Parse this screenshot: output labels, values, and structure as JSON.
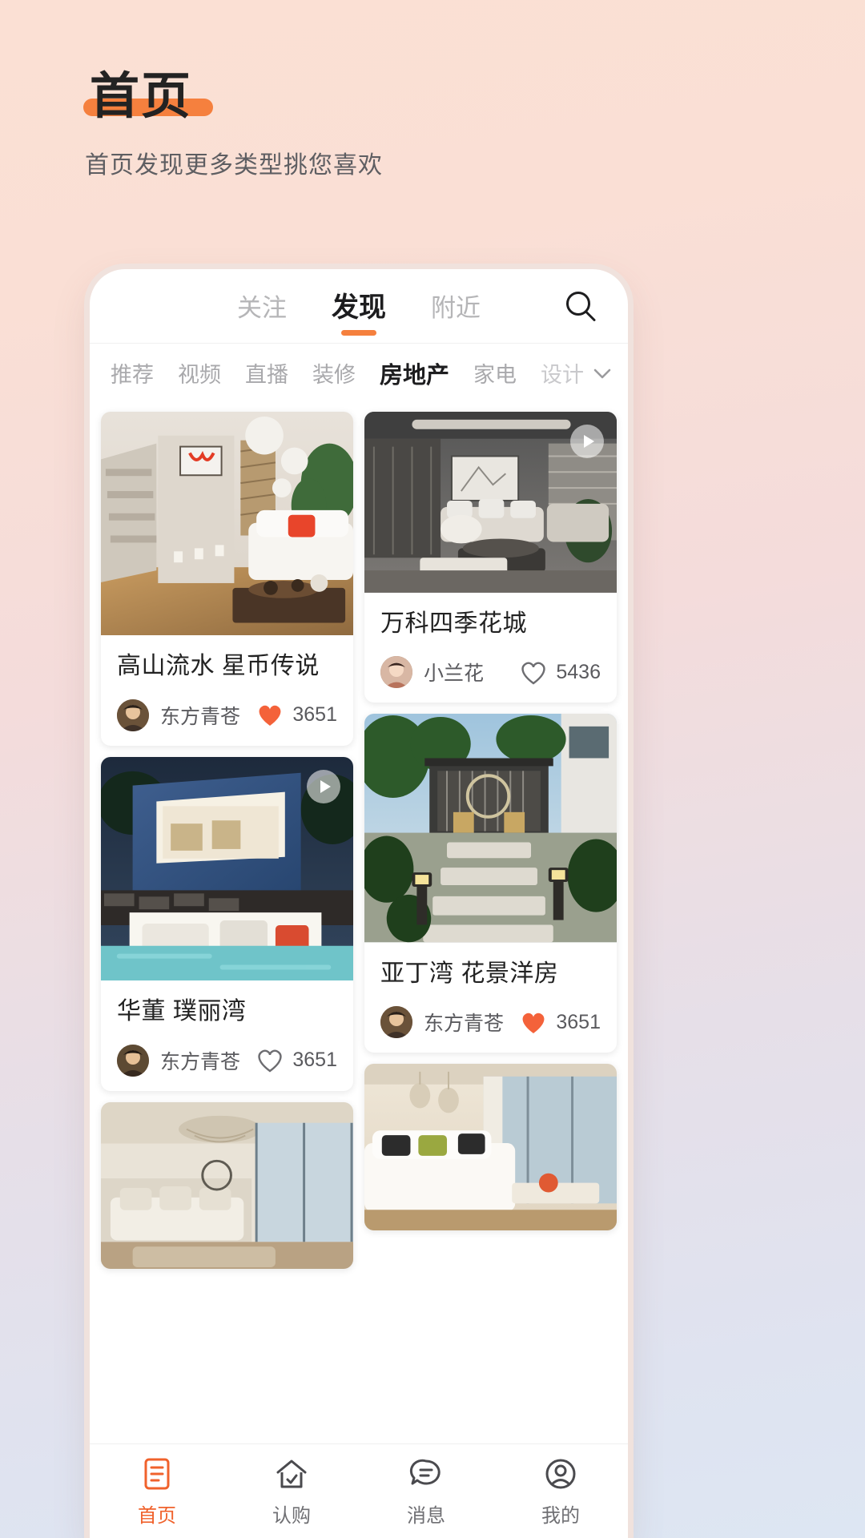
{
  "header": {
    "title": "首页",
    "subtitle": "首页发现更多类型挑您喜欢"
  },
  "colors": {
    "accent": "#f5803e",
    "accent_strong": "#f0622c",
    "heart_filled": "#f4623a",
    "text_dark": "#1d1d1f",
    "text_muted": "#a9a9ac"
  },
  "phone": {
    "topbar": {
      "tabs": [
        {
          "label": "关注",
          "active": false
        },
        {
          "label": "发现",
          "active": true
        },
        {
          "label": "附近",
          "active": false
        }
      ],
      "search_icon": "search-icon"
    },
    "categories": {
      "items": [
        {
          "label": "推荐",
          "active": false
        },
        {
          "label": "视频",
          "active": false
        },
        {
          "label": "直播",
          "active": false
        },
        {
          "label": "装修",
          "active": false
        },
        {
          "label": "房地产",
          "active": true
        },
        {
          "label": "家电",
          "active": false
        },
        {
          "label": "设计",
          "active": false,
          "faded": true
        }
      ],
      "expand_icon": "chevron-down-icon"
    },
    "feed": {
      "left_column": [
        {
          "title": "高山流水 星币传说",
          "author": "东方青苍",
          "likes": "3651",
          "liked": true,
          "has_video": false,
          "image": "living-room-stairs-red-art"
        },
        {
          "title": "华董 璞丽湾",
          "author": "东方青苍",
          "likes": "3651",
          "liked": false,
          "has_video": true,
          "image": "modern-blue-villa-pool-night"
        },
        {
          "title": "",
          "author": "",
          "likes": "",
          "liked": false,
          "has_video": false,
          "image": "classic-living-room-chandelier"
        }
      ],
      "right_column": [
        {
          "title": "万科四季花城",
          "author": "小兰花",
          "likes": "5436",
          "liked": false,
          "has_video": true,
          "image": "grey-modern-lounge-sofas"
        },
        {
          "title": "亚丁湾 花景洋房",
          "author": "东方青苍",
          "likes": "3651",
          "liked": true,
          "has_video": false,
          "image": "garden-courtyard-pavilion"
        },
        {
          "title": "",
          "author": "",
          "likes": "",
          "liked": false,
          "has_video": false,
          "image": "bright-corner-sofa-window"
        }
      ]
    },
    "bottom_nav": [
      {
        "label": "首页",
        "icon": "home-list-icon",
        "active": true
      },
      {
        "label": "认购",
        "icon": "house-icon",
        "active": false
      },
      {
        "label": "消息",
        "icon": "message-icon",
        "active": false
      },
      {
        "label": "我的",
        "icon": "user-icon",
        "active": false
      }
    ]
  }
}
